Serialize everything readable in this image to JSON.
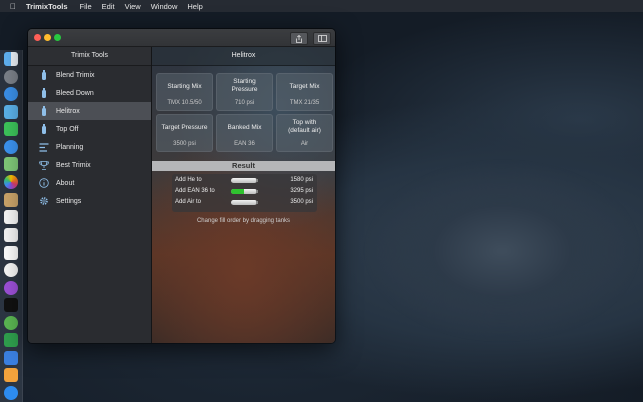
{
  "menubar": {
    "app_name": "TrimixTools",
    "items": [
      "File",
      "Edit",
      "View",
      "Window",
      "Help"
    ]
  },
  "window": {
    "sidebar_title": "Trimix Tools",
    "main_title": "Helitrox"
  },
  "sidebar": {
    "items": [
      {
        "label": "Blend Trimix",
        "icon": "tank-icon",
        "selected": false
      },
      {
        "label": "Bleed Down",
        "icon": "tank-icon",
        "selected": false
      },
      {
        "label": "Helitrox",
        "icon": "tank-icon",
        "selected": true
      },
      {
        "label": "Top Off",
        "icon": "tank-icon",
        "selected": false
      },
      {
        "label": "Planning",
        "icon": "planning-icon",
        "selected": false
      },
      {
        "label": "Best Trimix",
        "icon": "trophy-icon",
        "selected": false
      },
      {
        "label": "About",
        "icon": "info-icon",
        "selected": false
      },
      {
        "label": "Settings",
        "icon": "gear-icon",
        "selected": false
      }
    ]
  },
  "cards": [
    {
      "title": "Starting Mix",
      "value": "TMX 10.5/50"
    },
    {
      "title": "Starting Pressure",
      "value": "710 psi"
    },
    {
      "title": "Target Mix",
      "value": "TMX 21/35"
    },
    {
      "title": "Target Pressure",
      "value": "3500 psi"
    },
    {
      "title": "Banked Mix",
      "value": "EAN 36"
    },
    {
      "title": "Top with (default air)",
      "value": "Air"
    }
  ],
  "result": {
    "label": "Result",
    "rows": [
      {
        "label": "Add He to",
        "value": "1580 psi",
        "fill": 0.0,
        "fill_color": "#e0e0e0"
      },
      {
        "label": "Add EAN 36 to",
        "value": "3295 psi",
        "fill": 0.5,
        "fill_color": "#2fc22f"
      },
      {
        "label": "Add Air to",
        "value": "3500 psi",
        "fill": 0.0,
        "fill_color": "#e0e0e0"
      }
    ],
    "note": "Change fill order by dragging tanks"
  },
  "colors": {
    "accent": "#7fb2e6",
    "selected_row": "#4c4f55"
  }
}
